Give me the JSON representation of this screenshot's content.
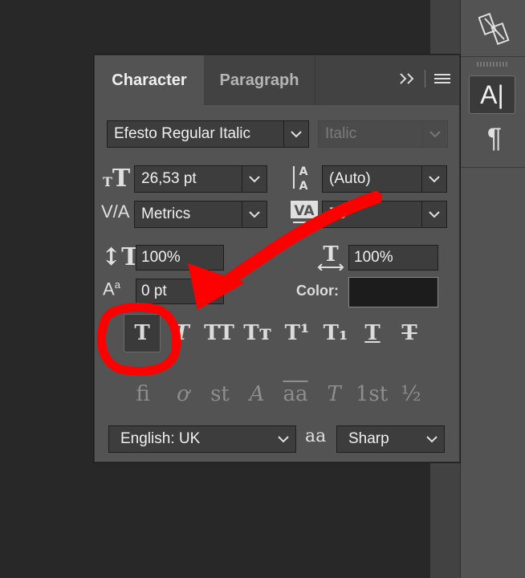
{
  "panel": {
    "tabs": [
      {
        "label": "Character",
        "active": true
      },
      {
        "label": "Paragraph",
        "active": false
      }
    ],
    "font_family": "Efesto Regular Italic",
    "font_style": "Italic",
    "font_size": "26,53 pt",
    "leading": "(Auto)",
    "kerning": "Metrics",
    "tracking": "75",
    "vertical_scale": "100%",
    "horizontal_scale": "100%",
    "baseline_shift": "0 pt",
    "color_label": "Color:",
    "color_value": "#1c1c1c",
    "style_buttons": [
      "T",
      "T",
      "TT",
      "Tт",
      "T¹",
      "T₁",
      "T",
      "T"
    ],
    "opentype_buttons": [
      "ﬁ",
      "ơ",
      "st",
      "A",
      "aa",
      "T",
      "1st",
      "½"
    ],
    "language": "English: UK",
    "aa_glyph": "aa",
    "antialias": "Sharp"
  },
  "dock": {
    "char_icon_glyph": "A",
    "para_icon_glyph": "¶"
  },
  "annotation": {
    "color": "#ff0000"
  }
}
